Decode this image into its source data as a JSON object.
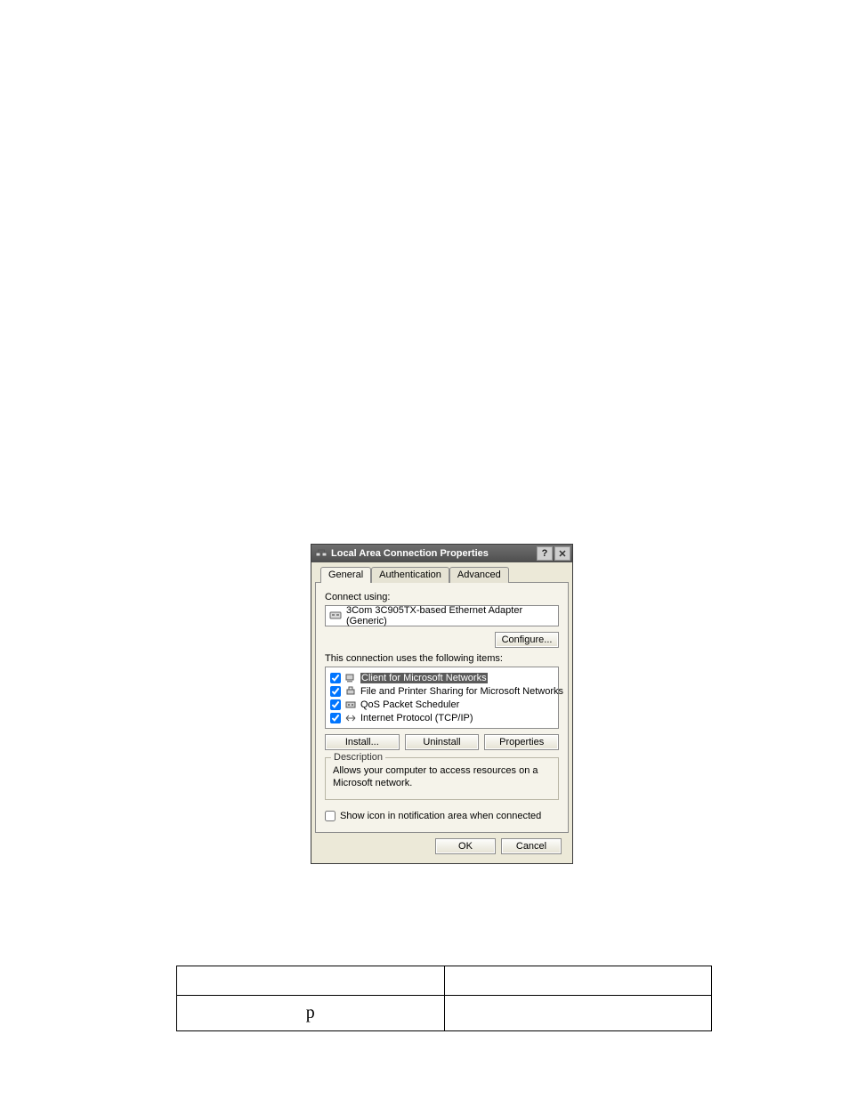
{
  "dialog": {
    "title": "Local Area Connection Properties",
    "tabs": [
      "General",
      "Authentication",
      "Advanced"
    ],
    "active_tab": 0,
    "connect_using_label": "Connect using:",
    "adapter": "3Com 3C905TX-based Ethernet Adapter (Generic)",
    "configure_label": "Configure...",
    "items_label": "This connection uses the following items:",
    "items": [
      {
        "label": "Client for Microsoft Networks",
        "checked": true,
        "selected": true,
        "icon": "computer-icon"
      },
      {
        "label": "File and Printer Sharing for Microsoft Networks",
        "checked": true,
        "selected": false,
        "icon": "printer-icon"
      },
      {
        "label": "QoS Packet Scheduler",
        "checked": true,
        "selected": false,
        "icon": "device-icon"
      },
      {
        "label": "Internet Protocol (TCP/IP)",
        "checked": true,
        "selected": false,
        "icon": "protocol-icon"
      }
    ],
    "install_label": "Install...",
    "uninstall_label": "Uninstall",
    "properties_label": "Properties",
    "description_legend": "Description",
    "description_text": "Allows your computer to access resources on a Microsoft network.",
    "show_icon_label": "Show icon in notification area when connected",
    "show_icon_checked": false,
    "ok_label": "OK",
    "cancel_label": "Cancel",
    "help_glyph": "?",
    "close_glyph": "✕"
  },
  "table": {
    "rows": [
      [
        "",
        ""
      ],
      [
        "p",
        ""
      ]
    ]
  }
}
